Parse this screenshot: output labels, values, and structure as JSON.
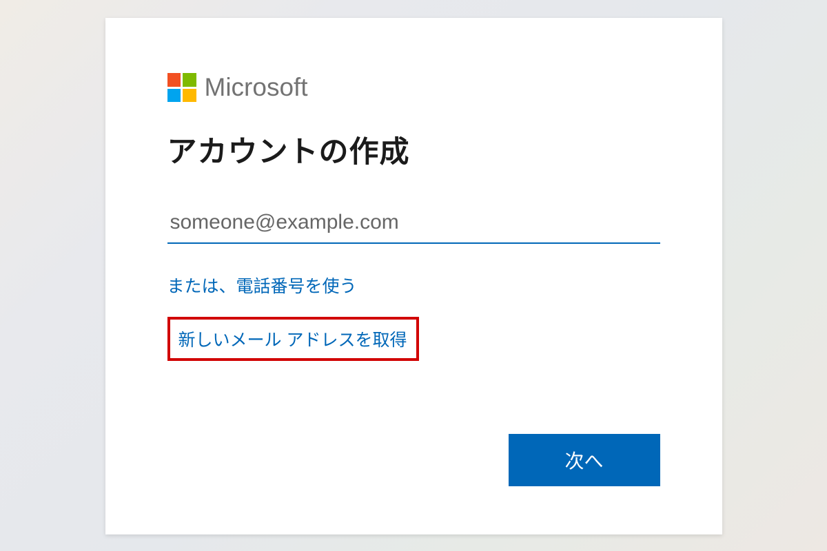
{
  "brand": {
    "name": "Microsoft",
    "colors": {
      "accent": "#0067b8",
      "logo_red": "#f25022",
      "logo_green": "#7fba00",
      "logo_blue": "#00a4ef",
      "logo_yellow": "#ffb900"
    }
  },
  "form": {
    "heading": "アカウントの作成",
    "email": {
      "value": "",
      "placeholder": "someone@example.com"
    },
    "links": {
      "use_phone": "または、電話番号を使う",
      "get_new_email": "新しいメール アドレスを取得"
    },
    "next_button": "次へ"
  },
  "annotation": {
    "highlight_color": "#d10000"
  }
}
